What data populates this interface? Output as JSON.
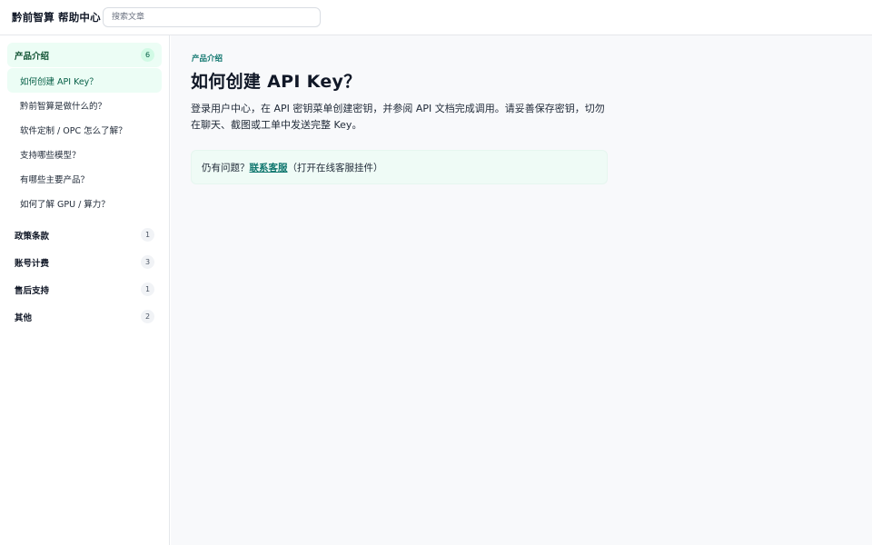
{
  "header": {
    "brand": "黔前智算 帮助中心",
    "search_placeholder": "搜索文章"
  },
  "sidebar": {
    "categories": [
      {
        "label": "产品介绍",
        "count": "6",
        "items": [
          "如何创建 API Key？",
          "黔前智算是做什么的？",
          "软件定制 / OPC 怎么了解？",
          "支持哪些模型？",
          "有哪些主要产品？",
          "如何了解 GPU / 算力？"
        ]
      },
      {
        "label": "政策条款",
        "count": "1"
      },
      {
        "label": "账号计费",
        "count": "3"
      },
      {
        "label": "售后支持",
        "count": "1"
      },
      {
        "label": "其他",
        "count": "2"
      }
    ]
  },
  "article": {
    "category": "产品介绍",
    "title": "如何创建 API Key？",
    "body": "登录用户中心，在 API 密钥菜单创建密钥，并参阅 API 文档完成调用。请妥善保存密钥，切勿在聊天、截图或工单中发送完整 Key。",
    "help_prefix": "仍有问题？",
    "help_link": "联系客服",
    "help_suffix": "（打开在线客服挂件）"
  },
  "colors": {
    "accent": "#0f766e",
    "active_bg": "#ecfdf5",
    "help_bg": "#effbf6"
  }
}
